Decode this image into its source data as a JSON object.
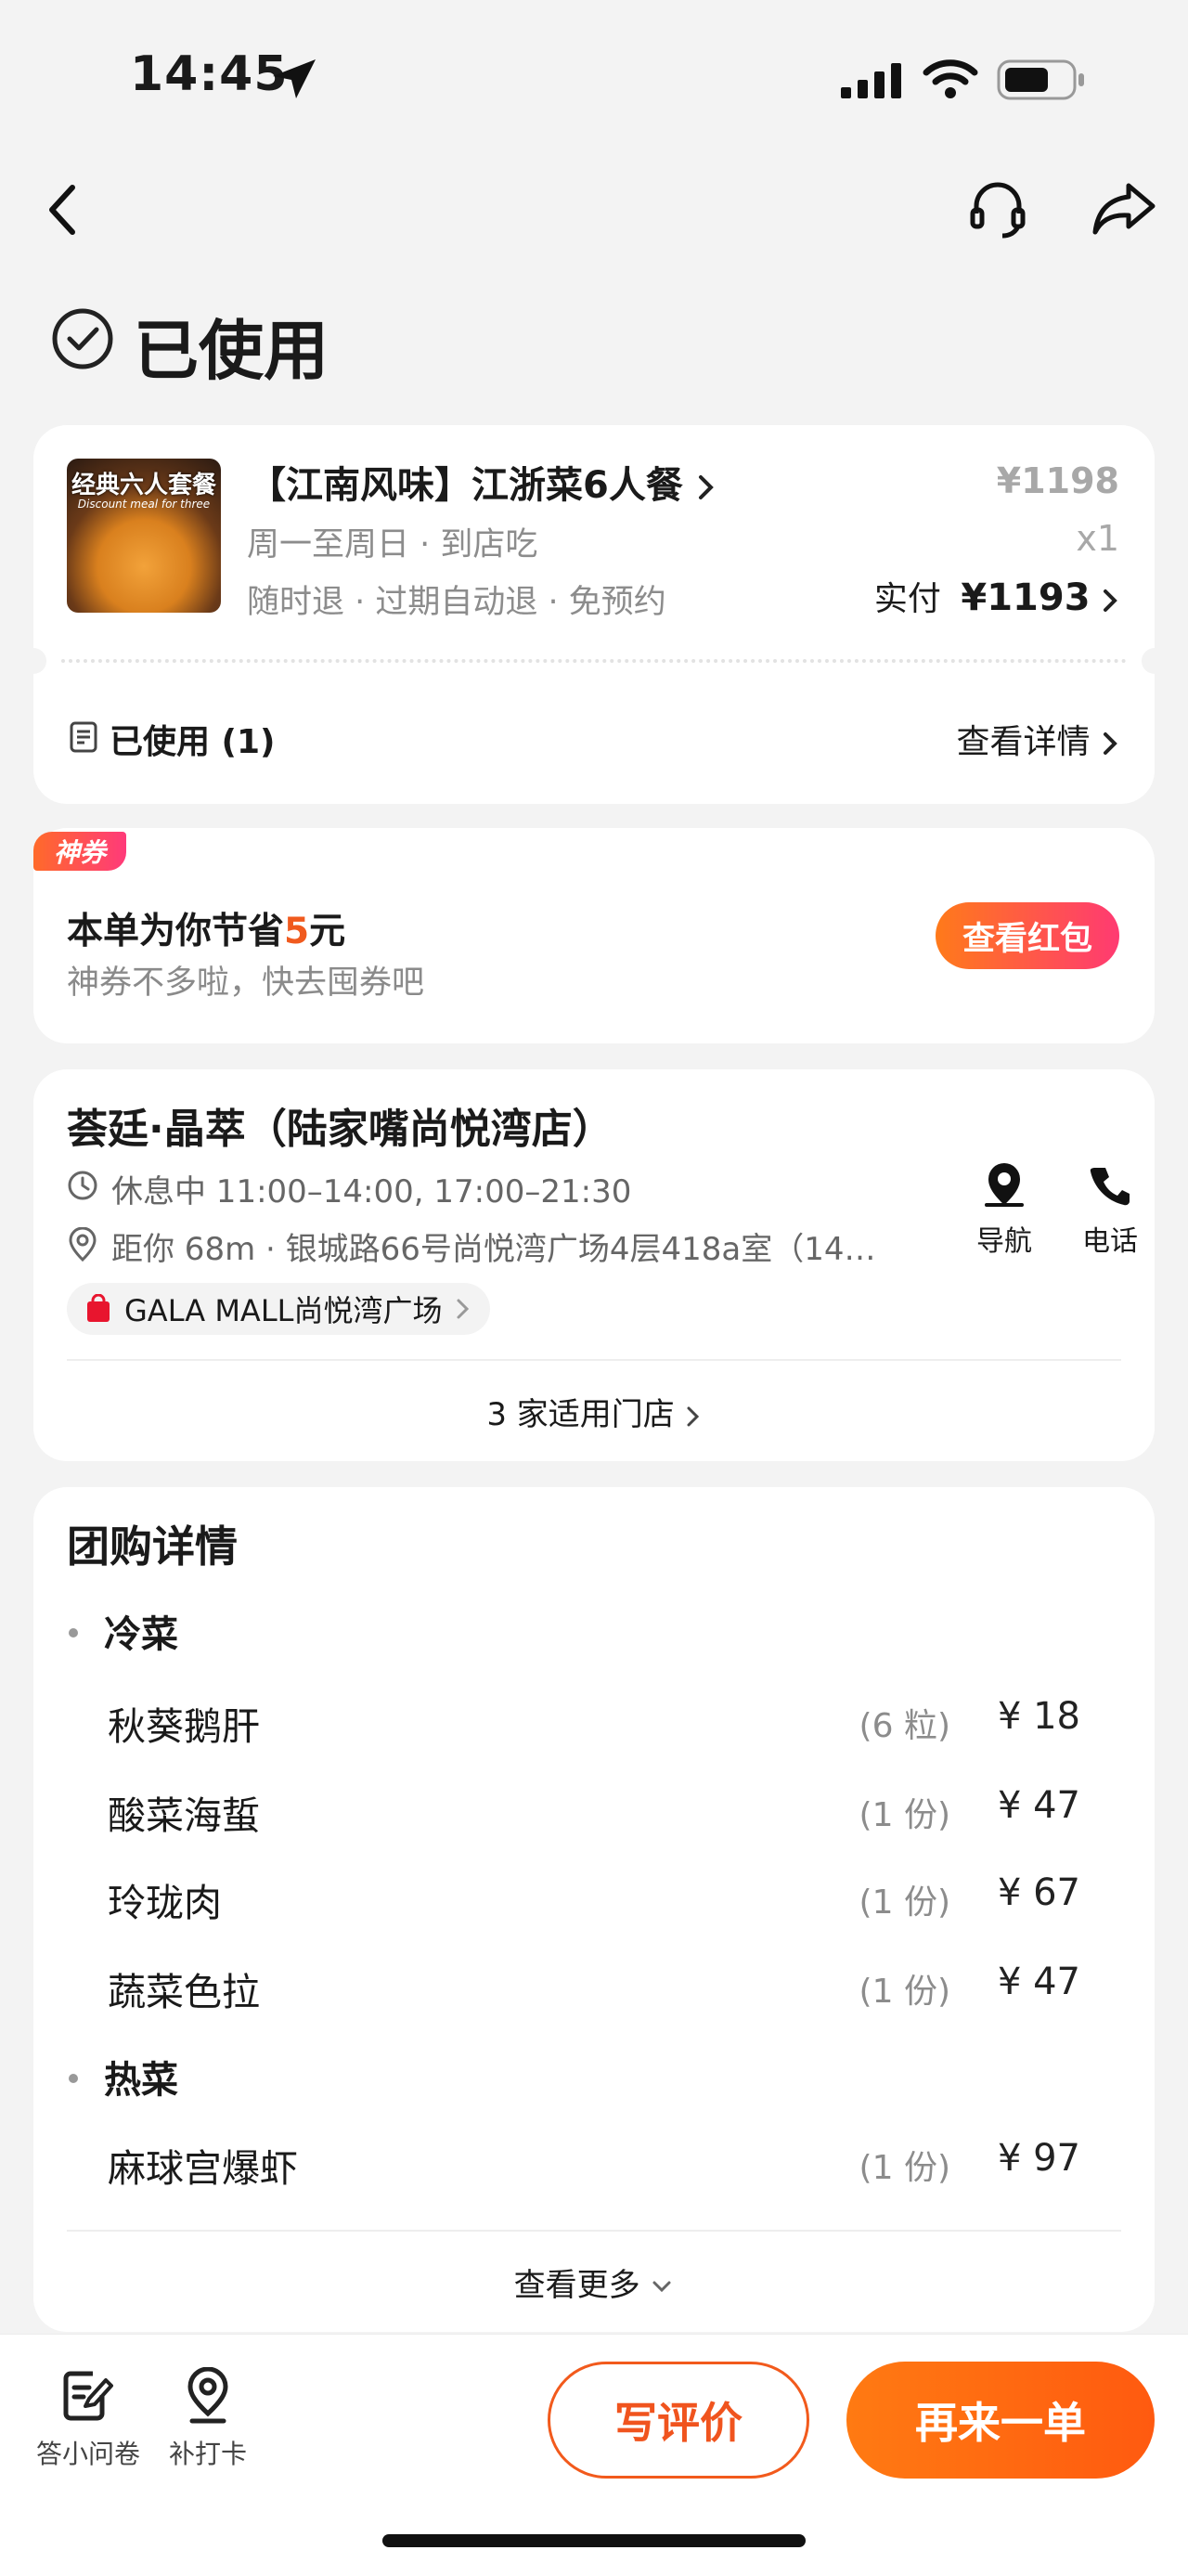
{
  "status_bar": {
    "time": "14:45"
  },
  "header": {
    "status_title": "已使用"
  },
  "order": {
    "thumb_text": "经典六人套餐",
    "thumb_sub": "Discount meal for three",
    "title": "【江南风味】江浙菜6人餐",
    "days": "周一至周日 · 到店吃",
    "policy": "随时退 · 过期自动退 · 免预约",
    "original_price": "¥1198",
    "quantity": "x1",
    "paid_label": "实付",
    "paid_amount": "¥1193",
    "used_label": "已使用 (1)",
    "details_link": "查看详情"
  },
  "coupon": {
    "badge": "神券",
    "saving_prefix": "本单为你节省",
    "saving_amount": "5",
    "saving_suffix": "元",
    "subtitle": "神券不多啦，快去囤券吧",
    "button": "查看红包"
  },
  "store": {
    "name": "荟廷·晶萃（陆家嘴尚悦湾店）",
    "hours": "休息中 11:00–14:00, 17:00–21:30",
    "address": "距你 68m ·  银城路66号尚悦湾广场4层418a室（14…",
    "mall_tag": "GALA MALL尚悦湾广场",
    "nav_label": "导航",
    "phone_label": "电话",
    "stores_link": "3 家适用门店"
  },
  "group_details": {
    "title": "团购详情",
    "sections": [
      {
        "name": "冷菜",
        "items": [
          {
            "name": "秋葵鹅肝",
            "qty": "(6 粒)",
            "price": "¥ 18"
          },
          {
            "name": "酸菜海蜇",
            "qty": "(1 份)",
            "price": "¥ 47"
          },
          {
            "name": "玲珑肉",
            "qty": "(1 份)",
            "price": "¥ 67"
          },
          {
            "name": "蔬菜色拉",
            "qty": "(1 份)",
            "price": "¥ 47"
          }
        ]
      },
      {
        "name": "热菜",
        "items": [
          {
            "name": "麻球宫爆虾",
            "qty": "(1 份)",
            "price": "¥ 97"
          }
        ]
      }
    ],
    "more_link": "查看更多"
  },
  "bottom_bar": {
    "survey_label": "答小问卷",
    "checkin_label": "补打卡",
    "review_button": "写评价",
    "reorder_button": "再来一单"
  },
  "colors": {
    "accent": "#ff5a10",
    "coupon_pink": "#ff3a6a",
    "saving_orange": "#f05a1e"
  }
}
